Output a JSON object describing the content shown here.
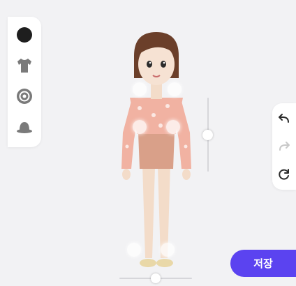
{
  "left_toolbar": {
    "items": [
      {
        "name": "hair-tool",
        "icon": "hair-icon"
      },
      {
        "name": "clothes-tool",
        "icon": "shirt-icon"
      },
      {
        "name": "accessory-tool",
        "icon": "target-icon"
      },
      {
        "name": "hat-tool",
        "icon": "hat-icon"
      }
    ]
  },
  "right_toolbar": {
    "items": [
      {
        "name": "undo",
        "icon": "undo-icon",
        "enabled": true
      },
      {
        "name": "redo",
        "icon": "redo-icon",
        "enabled": false
      },
      {
        "name": "reset",
        "icon": "refresh-icon",
        "enabled": true
      }
    ]
  },
  "sliders": {
    "vertical_level": 0.5,
    "horizontal_level": 0.5
  },
  "save_button": {
    "label": "저장"
  },
  "colors": {
    "accent": "#5b43f0",
    "icon_dark": "#2b2b2b",
    "icon_gray": "#7a7a7a",
    "icon_disabled": "#c8c8c8",
    "background": "#f2f2f4"
  }
}
